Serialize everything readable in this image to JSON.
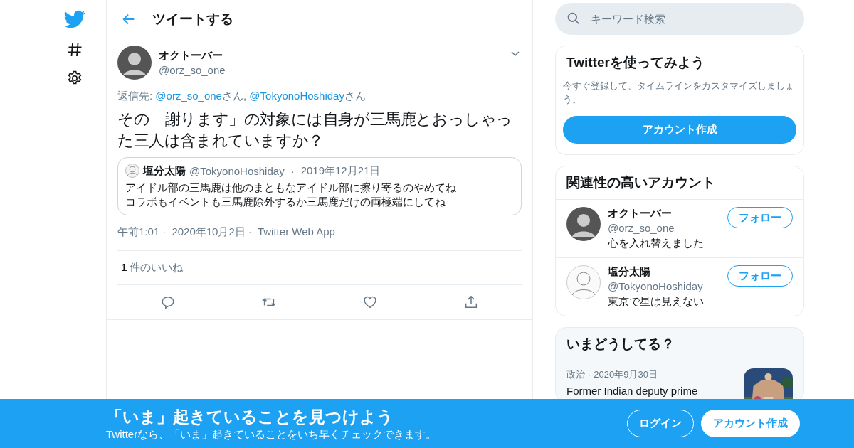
{
  "header": {
    "title": "ツイートする"
  },
  "tweet": {
    "name": "オクトーバー",
    "handle": "@orz_so_one",
    "reply_label": "返信先:",
    "reply_to": [
      {
        "handle": "@orz_so_one",
        "suffix": "さん,"
      },
      {
        "handle": "@TokyonoHoshiday",
        "suffix": "さん"
      }
    ],
    "text": "その「謝ります」の対象には自身が三馬鹿とおっしゃった三人は含まれていますか？",
    "quote": {
      "name": "塩分太陽",
      "handle": "@TokyonoHoshiday",
      "separator": "·",
      "date": "2019年12月21日",
      "lines": [
        "アイドル部の三馬鹿は他のまともなアイドル部に擦り寄るのやめてね",
        "コラボもイベントも三馬鹿除外するか三馬鹿だけの両極端にしてね"
      ]
    },
    "time": "午前1:01",
    "separator": "·",
    "date": "2020年10月2日",
    "source": "Twitter Web App",
    "likes_count": "1",
    "likes_label": "件のいいね"
  },
  "search": {
    "placeholder": "キーワード検索"
  },
  "signup_card": {
    "title": "Twitterを使ってみよう",
    "text": "今すぐ登録して、タイムラインをカスタマイズしましょう。",
    "button": "アカウント作成"
  },
  "related": {
    "title": "関連性の高いアカウント",
    "accounts": [
      {
        "name": "オクトーバー",
        "handle": "@orz_so_one",
        "bio": "心を入れ替えました",
        "button": "フォロー"
      },
      {
        "name": "塩分太陽",
        "handle": "@TokyonoHoshiday",
        "bio": "東京で星は見えない",
        "button": "フォロー"
      }
    ]
  },
  "trends": {
    "title": "いまどうしてる？",
    "items": [
      {
        "category": "政治",
        "separator": "·",
        "date": "2020年9月30日",
        "headline": "Former Indian deputy prime",
        "kind": "picture"
      }
    ]
  },
  "banner": {
    "title": "「いま」起きていることを見つけよう",
    "text": "Twitterなら、「いま」起きていることをいち早くチェックできます。",
    "login": "ログイン",
    "signup": "アカウント作成"
  }
}
